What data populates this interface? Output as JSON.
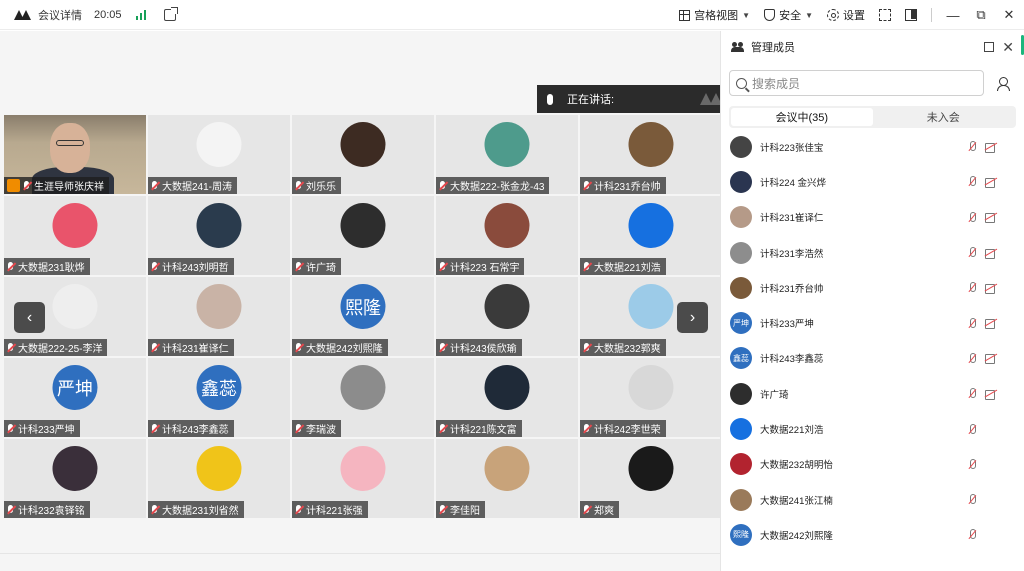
{
  "titlebar": {
    "title": "会议详情",
    "time": "20:05",
    "grid_view": "宫格视图",
    "security": "安全",
    "settings": "设置",
    "minimize": "—",
    "restore": "⧉",
    "close": "✕"
  },
  "speaking": {
    "label": "正在讲话:"
  },
  "host_tile": {
    "name": "生涯导师张庆祥"
  },
  "tiles": [
    {
      "name": "大数据241-周涛",
      "color": "#f4f4f4",
      "text": ""
    },
    {
      "name": "刘乐乐",
      "color": "#3d2b22",
      "text": ""
    },
    {
      "name": "大数据222-张金龙-43",
      "color": "#4e9b8c",
      "text": ""
    },
    {
      "name": "计科231乔台帅",
      "color": "#7a5a3a",
      "text": ""
    },
    {
      "name": "大数据231耿烨",
      "color": "#e9546b",
      "text": ""
    },
    {
      "name": "计科243刘明哲",
      "color": "#2a3b4d",
      "text": ""
    },
    {
      "name": "许广琦",
      "color": "#2d2d2d",
      "text": ""
    },
    {
      "name": "计科223 石常宇",
      "color": "#8a4b3c",
      "text": ""
    },
    {
      "name": "大数据221刘浩",
      "color": "#1670e0",
      "text": ""
    },
    {
      "name": "大数据222-25-李洋",
      "color": "#eeeeee",
      "text": ""
    },
    {
      "name": "计科231崔译仁",
      "color": "#c9b3a6",
      "text": ""
    },
    {
      "name": "大数据242刘熙隆",
      "color": "#2f6fbf",
      "text": "熙隆"
    },
    {
      "name": "计科243侯欣瑜",
      "color": "#3a3a3a",
      "text": ""
    },
    {
      "name": "大数据232郭爽",
      "color": "#9ccbe8",
      "text": ""
    },
    {
      "name": "计科233严坤",
      "color": "#2f6fbf",
      "text": "严坤"
    },
    {
      "name": "计科243李鑫蕊",
      "color": "#2f6fbf",
      "text": "鑫蕊"
    },
    {
      "name": "李瑞波",
      "color": "#8c8c8c",
      "text": ""
    },
    {
      "name": "计科221陈文富",
      "color": "#1f2a38",
      "text": ""
    },
    {
      "name": "计科242李世荣",
      "color": "#d8d8d8",
      "text": ""
    },
    {
      "name": "计科232袁铎铭",
      "color": "#3a2f3a",
      "text": ""
    },
    {
      "name": "大数据231刘省然",
      "color": "#f0c419",
      "text": ""
    },
    {
      "name": "计科221张强",
      "color": "#f5b5c0",
      "text": ""
    },
    {
      "name": "李佳阳",
      "color": "#c8a37a",
      "text": ""
    },
    {
      "name": "郑爽",
      "color": "#1a1a1a",
      "text": ""
    }
  ],
  "panel": {
    "title": "管理成员",
    "search_placeholder": "搜索成员",
    "tab_in_meeting": "会议中(35)",
    "tab_not_joined": "未入会"
  },
  "members": [
    {
      "name": "计科223张佳宝",
      "color": "#444444",
      "text": "",
      "cam": true
    },
    {
      "name": "计科224 金兴烨",
      "color": "#2a3550",
      "text": "",
      "cam": true
    },
    {
      "name": "计科231崔译仁",
      "color": "#b59a88",
      "text": "",
      "cam": true
    },
    {
      "name": "计科231李浩然",
      "color": "#8d8d8d",
      "text": "",
      "cam": true
    },
    {
      "name": "计科231乔台帅",
      "color": "#7a5a3a",
      "text": "",
      "cam": true
    },
    {
      "name": "计科233严坤",
      "color": "#2f6fbf",
      "text": "严坤",
      "cam": true
    },
    {
      "name": "计科243李鑫蕊",
      "color": "#2f6fbf",
      "text": "鑫蕊",
      "cam": true
    },
    {
      "name": "许广琦",
      "color": "#2d2d2d",
      "text": "",
      "cam": true
    },
    {
      "name": "大数据221刘浩",
      "color": "#1670e0",
      "text": "",
      "cam": false
    },
    {
      "name": "大数据232胡明怡",
      "color": "#b2232f",
      "text": "",
      "cam": false
    },
    {
      "name": "大数据241张江楠",
      "color": "#9a7a5a",
      "text": "",
      "cam": false
    },
    {
      "name": "大数据242刘熙隆",
      "color": "#2f6fbf",
      "text": "熙隆",
      "cam": false
    }
  ]
}
